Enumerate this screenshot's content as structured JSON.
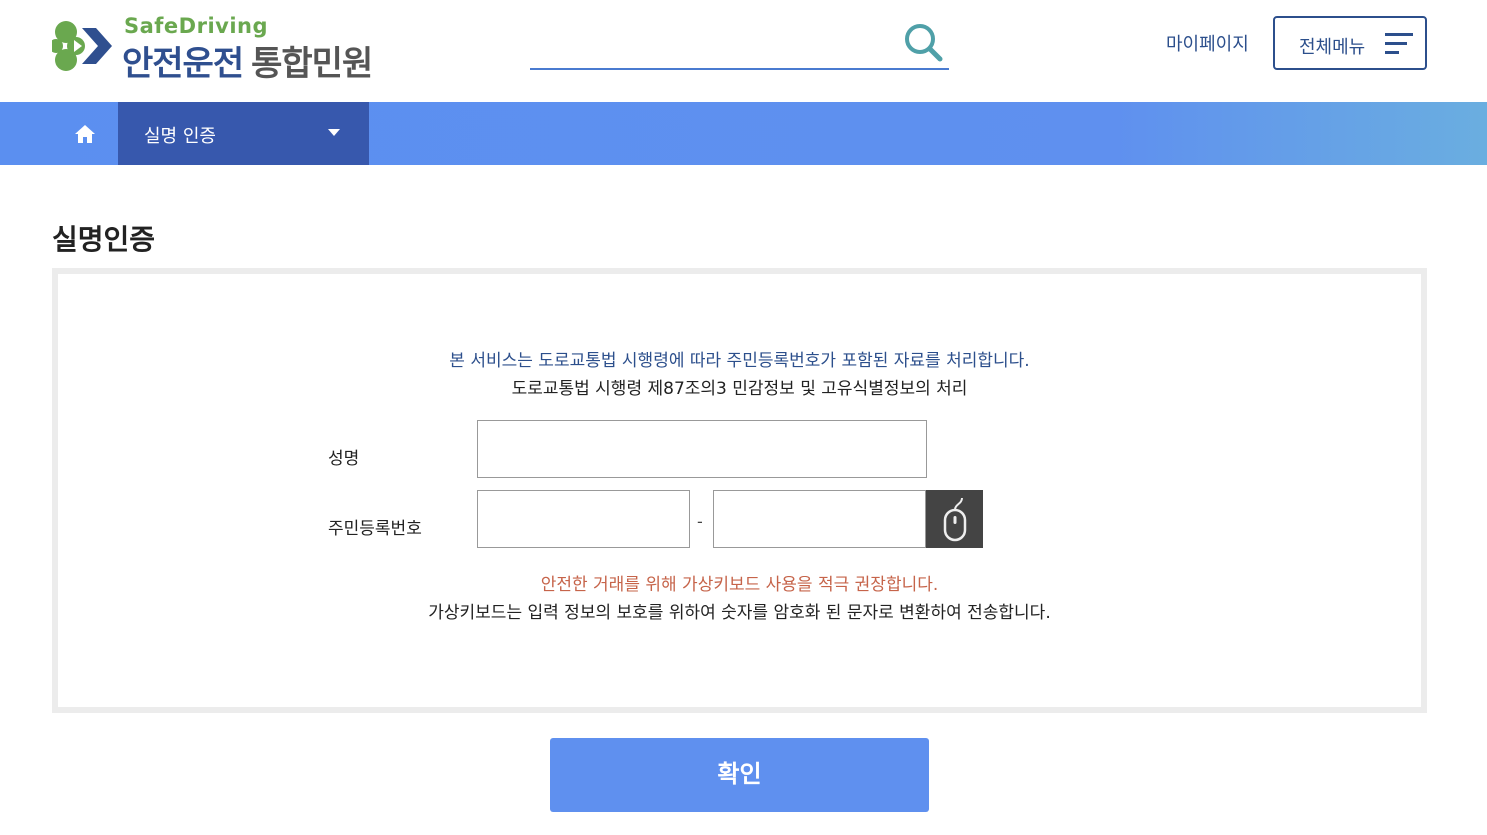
{
  "header": {
    "logo_sub": "SafeDriving",
    "logo_main": "안전운전",
    "logo_main_suffix": "통합민원",
    "search_placeholder": "",
    "mypage_label": "마이페이지",
    "allmenu_label": "전체메뉴"
  },
  "nav": {
    "dropdown_label": "실명 인증"
  },
  "main": {
    "page_title": "실명인증",
    "notice_line1": "본 서비스는 도로교통법 시행령에 따라 주민등록번호가 포함된 자료를 처리합니다.",
    "notice_line2": "도로교통법 시행령 제87조의3 민감정보 및 고유식별정보의 처리",
    "name_label": "성명",
    "name_value": "",
    "rrn_label": "주민등록번호",
    "rrn_front_value": "",
    "rrn_dash": "-",
    "rrn_back_value": "",
    "warning_line1": "안전한 거래를 위해 가상키보드 사용을 적극 권장합니다.",
    "warning_line2": "가상키보드는 입력 정보의 보호를 위하여 숫자를 암호화 된 문자로 변환하여 전송합니다.",
    "confirm_label": "확인"
  },
  "colors": {
    "brand_blue": "#2c4f8c",
    "nav_blue": "#5f90ef",
    "nav_active": "#3758ad",
    "logo_green": "#6aa84f",
    "warning_red": "#c6644a"
  },
  "icons": {
    "logo": "clover-logo-icon",
    "search": "search-icon",
    "menu": "hamburger-icon",
    "home": "home-icon",
    "caret": "caret-down-icon",
    "virtual_keyboard": "mouse-icon"
  }
}
